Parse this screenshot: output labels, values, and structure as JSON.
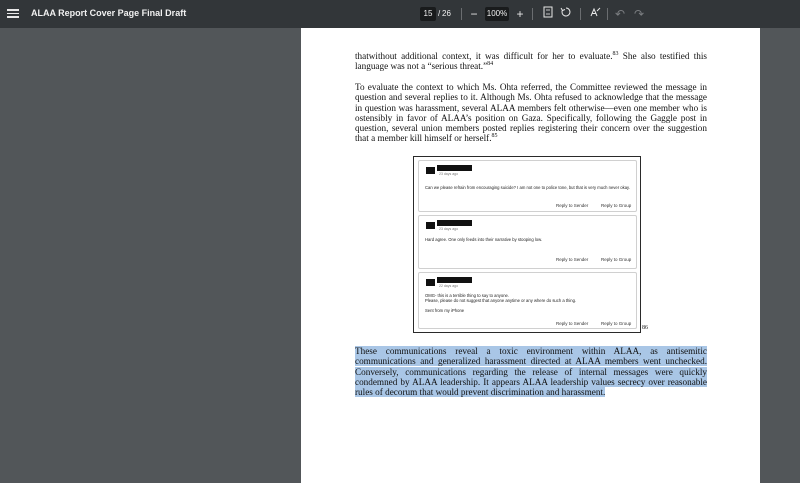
{
  "toolbar": {
    "title": "ALAA Report Cover Page Final Draft",
    "current_page": "15",
    "page_separator": "/",
    "total_pages": "26",
    "zoom": "100%"
  },
  "icons": {
    "menu": "menu-icon",
    "zoom_out": "minus-icon",
    "zoom_in": "plus-icon",
    "fit": "fit-page-icon",
    "rotate": "rotate-icon",
    "annotate": "annotate-icon",
    "undo": "undo-icon",
    "redo": "redo-icon"
  },
  "document": {
    "para1": "thatwithout additional context, it was difficult for her to evaluate.",
    "para1_fn1": "83",
    "para1_b": " She also testified this language was not a “serious threat.”",
    "para1_fn2": "84",
    "para2": "To evaluate the context to which Ms. Ohta referred, the Committee reviewed the message in question and several replies to it. Although Ms. Ohta refused to acknowledge that the message in question was harassment, several ALAA members felt otherwise—even one member who is ostensibly in favor of ALAA’s position on Gaza. Specifically, following the Gaggle post in question, several union members posted replies registering their concern over the suggestion that a member kill himself or herself.",
    "para2_fn": "85",
    "figure_fn": "86",
    "para3": "These communications reveal a toxic environment within ALAA, as antisemitic communications and generalized harassment directed at ALAA members went unchecked. Conversely, communications regarding the release of internal messages were quickly condemned by ALAA leadership. It appears ALAA leadership values secrecy over reasonable rules of decorum that would prevent discrimination and harassment."
  },
  "messages": [
    {
      "ago": "23 days ago",
      "lines": [
        "Can we please refrain from encouraging suicide? I am not one to police tone, but that is very much never okay."
      ],
      "reply_sender": "Reply to Sender",
      "reply_group": "Reply to Group"
    },
    {
      "ago": "23 days ago",
      "lines": [
        "Hard agree. One only feeds into their narrative by stooping low."
      ],
      "reply_sender": "Reply to Sender",
      "reply_group": "Reply to Group"
    },
    {
      "ago": "22 days ago",
      "lines": [
        "OMG- this is a terrible thing to say to anyone.",
        "Please, please do not suggest that anyone anytime or any where do such a thing.",
        "",
        "Sent from my iPhone"
      ],
      "reply_sender": "Reply to Sender",
      "reply_group": "Reply to Group"
    }
  ]
}
